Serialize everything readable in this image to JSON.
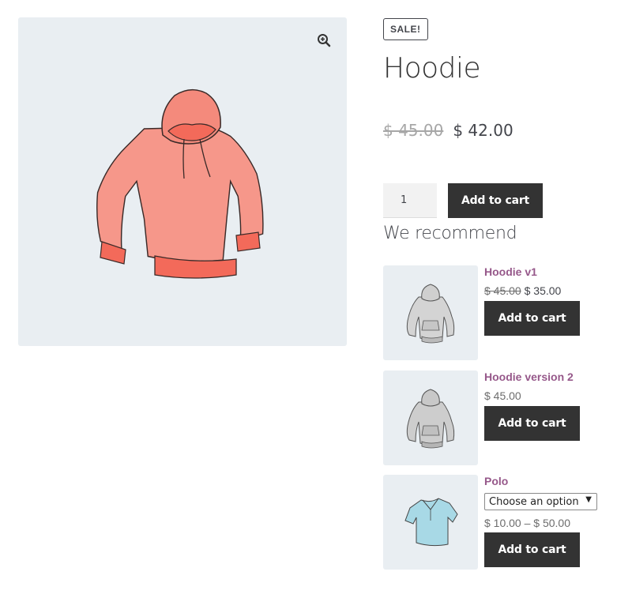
{
  "product": {
    "badge": "SALE!",
    "title": "Hoodie",
    "price_old": "$ 45.00",
    "price_new": "$ 42.00",
    "quantity": "1",
    "add_to_cart": "Add to cart",
    "image_icon": "hoodie-illustration",
    "zoom_icon": "magnifier-plus-icon",
    "colors": {
      "hoodie": "#f3877a",
      "hoodie_band": "#f36a5a",
      "background": "#e9eef2",
      "button": "#333333",
      "link": "#96588a"
    }
  },
  "recommend": {
    "title": "We recommend",
    "items": [
      {
        "name": "Hoodie v1",
        "price_old": "$ 45.00",
        "price_new": "$ 35.00",
        "button": "Add to cart",
        "icon": "grey-hoodie-illustration"
      },
      {
        "name": "Hoodie version 2",
        "price": "$ 45.00",
        "button": "Add to cart",
        "icon": "grey-hoodie-illustration"
      },
      {
        "name": "Polo",
        "select_value": "Choose an option",
        "price_range": "$ 10.00 – $ 50.00",
        "button": "Add to cart",
        "icon": "blue-polo-illustration"
      }
    ]
  }
}
